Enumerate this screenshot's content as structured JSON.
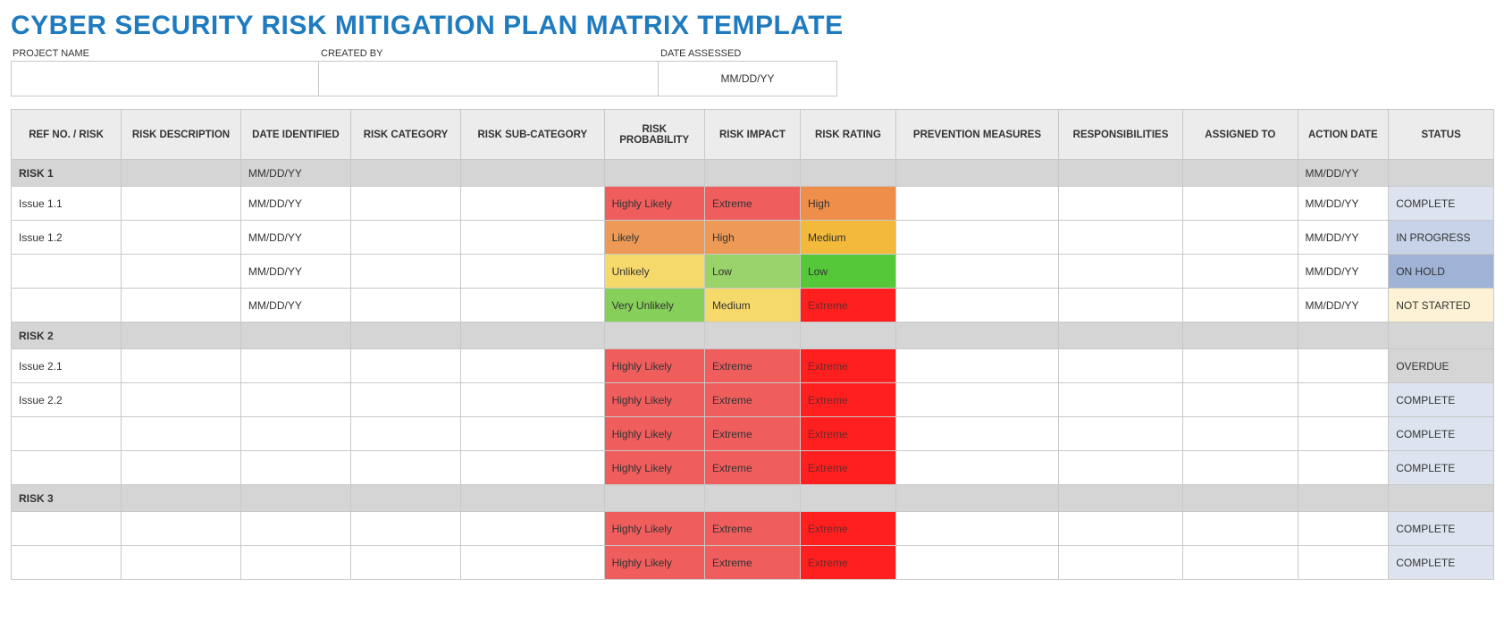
{
  "title": "CYBER SECURITY RISK MITIGATION PLAN MATRIX TEMPLATE",
  "meta": {
    "project_label": "PROJECT NAME",
    "project_value": "",
    "created_label": "CREATED BY",
    "created_value": "",
    "date_label": "DATE ASSESSED",
    "date_value": "MM/DD/YY"
  },
  "headers": {
    "ref": "REF NO. / RISK",
    "desc": "RISK DESCRIPTION",
    "dateid": "DATE IDENTIFIED",
    "cat": "RISK CATEGORY",
    "subcat": "RISK SUB-CATEGORY",
    "prob": "RISK PROBABILITY",
    "impact": "RISK IMPACT",
    "rating": "RISK RATING",
    "prev": "PREVENTION MEASURES",
    "resp": "RESPONSIBILITIES",
    "assign": "ASSIGNED TO",
    "action": "ACTION DATE",
    "status": "STATUS"
  },
  "rows": [
    {
      "type": "group",
      "ref": "RISK 1",
      "dateid": "MM/DD/YY",
      "action": "MM/DD/YY"
    },
    {
      "type": "data",
      "ref": "Issue 1.1",
      "dateid": "MM/DD/YY",
      "prob": "Highly Likely",
      "prob_cls": "bg-red",
      "impact": "Extreme",
      "impact_cls": "bg-red",
      "rating": "High",
      "rating_cls": "bg-orange",
      "action": "MM/DD/YY",
      "status": "COMPLETE",
      "status_cls": "st-complete"
    },
    {
      "type": "data",
      "ref": "Issue 1.2",
      "dateid": "MM/DD/YY",
      "prob": "Likely",
      "prob_cls": "bg-orange2",
      "impact": "High",
      "impact_cls": "bg-orange2",
      "rating": "Medium",
      "rating_cls": "bg-amber",
      "action": "MM/DD/YY",
      "status": "IN PROGRESS",
      "status_cls": "st-inprogress"
    },
    {
      "type": "data",
      "ref": "",
      "dateid": "MM/DD/YY",
      "prob": "Unlikely",
      "prob_cls": "bg-yellow",
      "impact": "Low",
      "impact_cls": "bg-green",
      "rating": "Low",
      "rating_cls": "bg-green-bright",
      "action": "MM/DD/YY",
      "status": "ON HOLD",
      "status_cls": "st-onhold"
    },
    {
      "type": "data",
      "ref": "",
      "dateid": "MM/DD/YY",
      "prob": "Very Unlikely",
      "prob_cls": "bg-green2",
      "impact": "Medium",
      "impact_cls": "bg-yellow",
      "rating": "Extreme",
      "rating_cls": "bg-red-bright",
      "action": "MM/DD/YY",
      "status": "NOT STARTED",
      "status_cls": "st-notstarted"
    },
    {
      "type": "group",
      "ref": "RISK 2"
    },
    {
      "type": "data",
      "ref": "Issue 2.1",
      "prob": "Highly Likely",
      "prob_cls": "bg-red",
      "impact": "Extreme",
      "impact_cls": "bg-red",
      "rating": "Extreme",
      "rating_cls": "bg-red-bright",
      "status": "OVERDUE",
      "status_cls": "st-overdue"
    },
    {
      "type": "data",
      "ref": "Issue 2.2",
      "prob": "Highly Likely",
      "prob_cls": "bg-red",
      "impact": "Extreme",
      "impact_cls": "bg-red",
      "rating": "Extreme",
      "rating_cls": "bg-red-bright",
      "status": "COMPLETE",
      "status_cls": "st-complete"
    },
    {
      "type": "data",
      "ref": "",
      "prob": "Highly Likely",
      "prob_cls": "bg-red",
      "impact": "Extreme",
      "impact_cls": "bg-red",
      "rating": "Extreme",
      "rating_cls": "bg-red-bright",
      "status": "COMPLETE",
      "status_cls": "st-complete"
    },
    {
      "type": "data",
      "ref": "",
      "prob": "Highly Likely",
      "prob_cls": "bg-red",
      "impact": "Extreme",
      "impact_cls": "bg-red",
      "rating": "Extreme",
      "rating_cls": "bg-red-bright",
      "status": "COMPLETE",
      "status_cls": "st-complete"
    },
    {
      "type": "group",
      "ref": "RISK 3"
    },
    {
      "type": "data",
      "ref": "",
      "prob": "Highly Likely",
      "prob_cls": "bg-red",
      "impact": "Extreme",
      "impact_cls": "bg-red",
      "rating": "Extreme",
      "rating_cls": "bg-red-bright",
      "status": "COMPLETE",
      "status_cls": "st-complete"
    },
    {
      "type": "data",
      "ref": "",
      "prob": "Highly Likely",
      "prob_cls": "bg-red",
      "impact": "Extreme",
      "impact_cls": "bg-red",
      "rating": "Extreme",
      "rating_cls": "bg-red-bright",
      "status": "COMPLETE",
      "status_cls": "st-complete"
    }
  ]
}
